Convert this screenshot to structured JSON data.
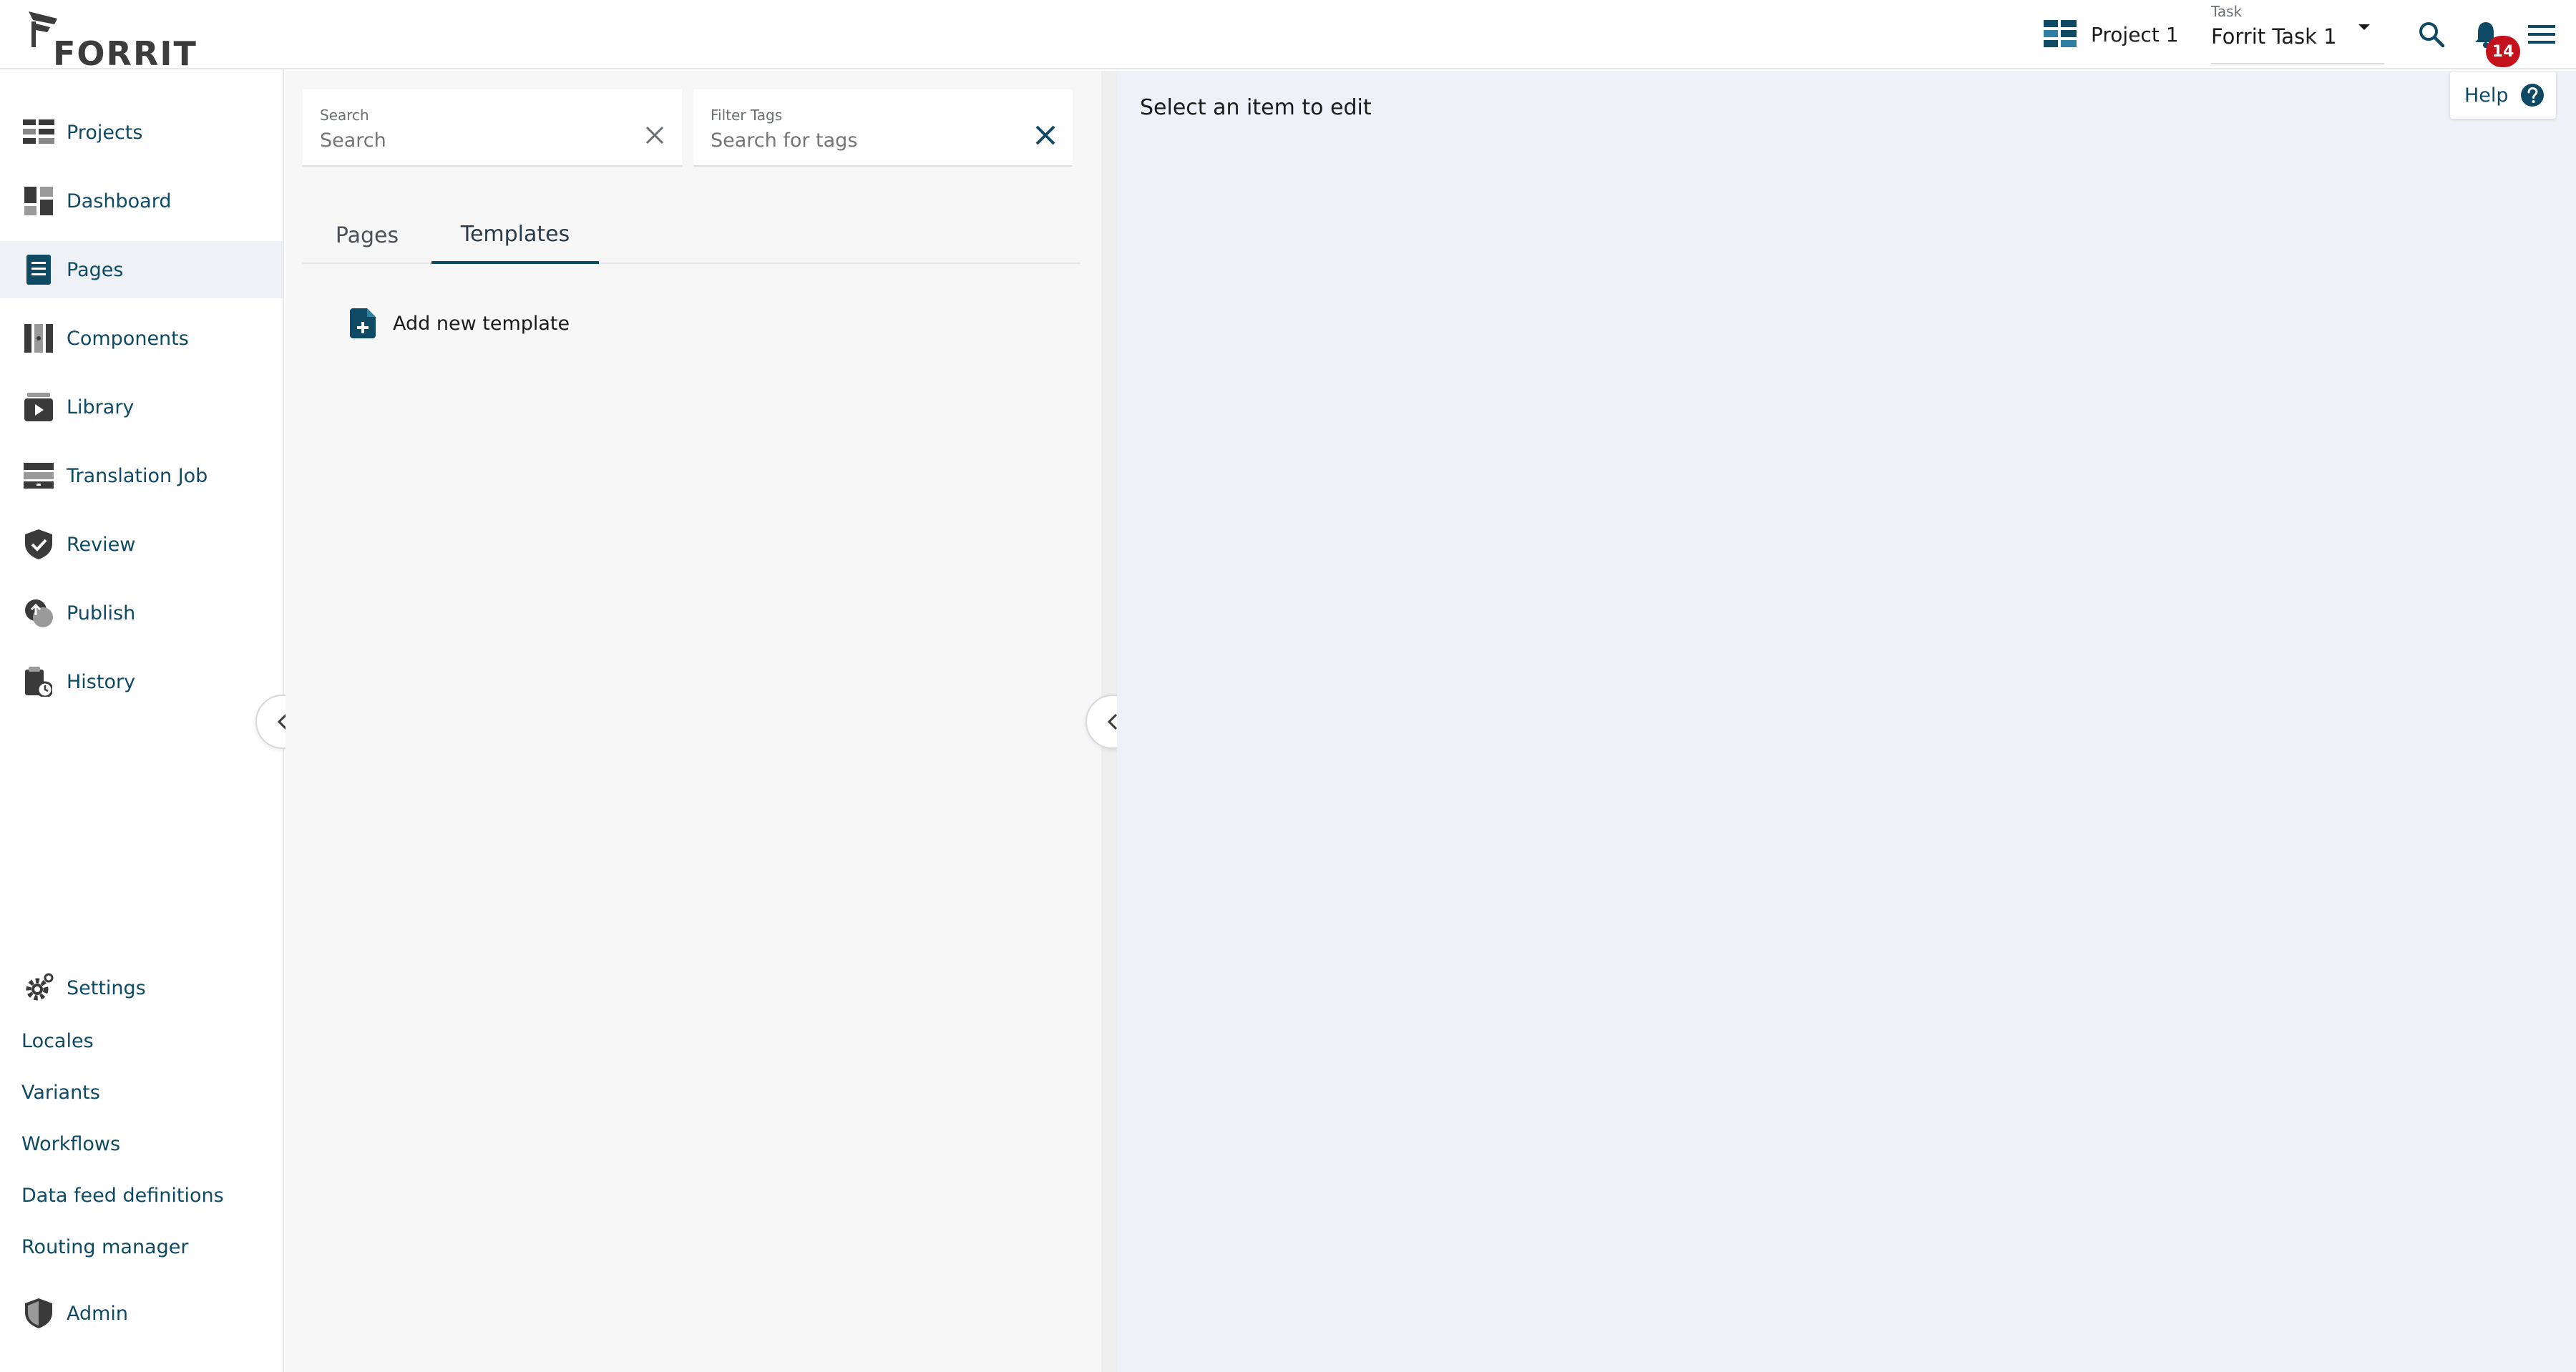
{
  "app": {
    "logo_text": "FORRIT"
  },
  "header": {
    "project_label": "Project 1",
    "task_small_label": "Task",
    "task_value": "Forrit Task 1",
    "notification_count": "14"
  },
  "sidebar": {
    "items": [
      {
        "label": "Projects",
        "icon": "projects-icon"
      },
      {
        "label": "Dashboard",
        "icon": "dashboard-icon"
      },
      {
        "label": "Pages",
        "icon": "pages-icon",
        "active": true
      },
      {
        "label": "Components",
        "icon": "components-icon"
      },
      {
        "label": "Library",
        "icon": "library-icon"
      },
      {
        "label": "Translation Job",
        "icon": "translation-icon"
      },
      {
        "label": "Review",
        "icon": "review-icon"
      },
      {
        "label": "Publish",
        "icon": "publish-icon"
      },
      {
        "label": "History",
        "icon": "history-icon"
      }
    ],
    "settings_label": "Settings",
    "settings_sub": [
      "Locales",
      "Variants",
      "Workflows",
      "Data feed definitions",
      "Routing manager"
    ],
    "admin_label": "Admin"
  },
  "list_panel": {
    "search": {
      "label": "Search",
      "placeholder": "Search"
    },
    "filter_tags": {
      "label": "Filter Tags",
      "placeholder": "Search for tags"
    },
    "tabs": [
      {
        "label": "Pages"
      },
      {
        "label": "Templates",
        "active": true
      }
    ],
    "add_new_label": "Add new template"
  },
  "editor": {
    "empty_message": "Select an item to edit"
  },
  "help": {
    "label": "Help"
  },
  "colors": {
    "accent": "#0e4a64",
    "badge": "#c4121c",
    "editor_bg": "#eef2f8",
    "list_bg": "#f7f7f7"
  }
}
